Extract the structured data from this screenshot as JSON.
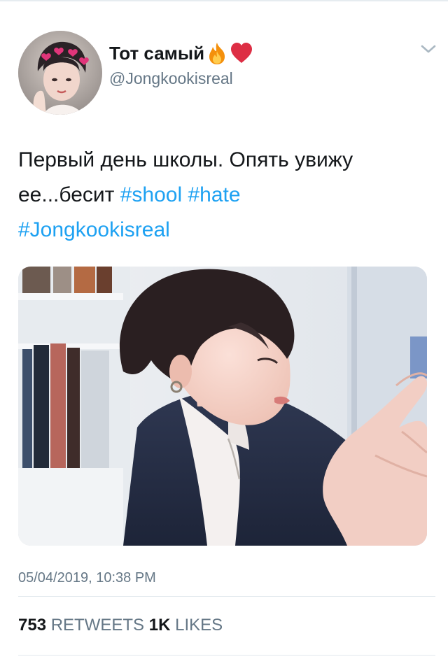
{
  "author": {
    "display_name": "Тот самый",
    "handle": "@Jongkookisreal",
    "name_emojis": [
      "fire-emoji",
      "red-heart-emoji"
    ],
    "avatar_icon": "profile-photo"
  },
  "tweet": {
    "text_plain": "Первый день школы. Опять увижу ее...бесит",
    "hashtags": [
      "#shool",
      "#hate",
      "#Jongkookisreal"
    ],
    "timestamp": "05/04/2019, 10:38 PM",
    "media_icon": "attached-photo"
  },
  "stats": {
    "retweets_count": "753",
    "retweets_label": "RETWEETS",
    "likes_count": "1K",
    "likes_label": "LIKES"
  },
  "colors": {
    "hashtag": "#1da1f2",
    "secondary_text": "#657786",
    "primary_text": "#14171a",
    "divider": "#e1e8ed"
  }
}
